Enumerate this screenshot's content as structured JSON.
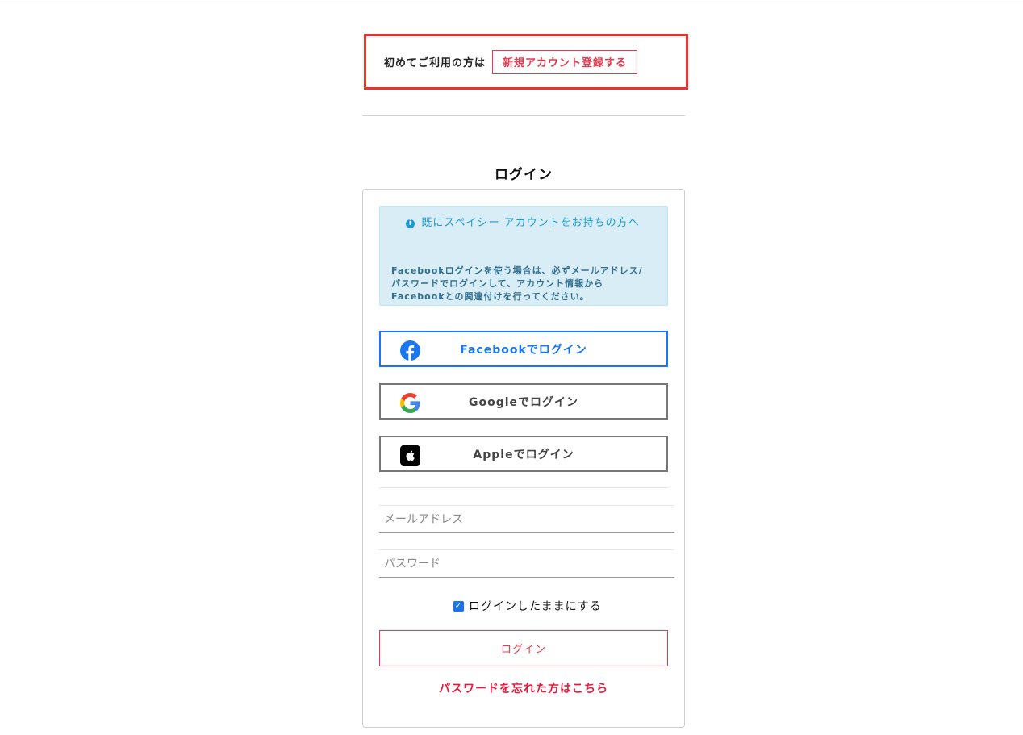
{
  "signup": {
    "lead_text": "初めてご利用の方は",
    "button_label": "新規アカウント登録する"
  },
  "login": {
    "title": "ログイン",
    "info": {
      "heading": "既にスペイシー アカウントをお持ちの方へ",
      "body": "Facebookログインを使う場合は、必ずメールアドレス/パスワードでログインして、アカウント情報からFacebookとの関連付けを行ってください。"
    },
    "social": {
      "facebook_label": "Facebookでログイン",
      "google_label": "Googleでログイン",
      "apple_label": "Appleでログイン"
    },
    "form": {
      "email_placeholder": "メールアドレス",
      "password_placeholder": "パスワード",
      "remember_label": "ログインしたままにする",
      "remember_checked": true,
      "submit_label": "ログイン",
      "forgot_link": "パスワードを忘れた方はこちら"
    }
  },
  "colors": {
    "accent_red": "#e23b50",
    "highlight_box": "#e8342c",
    "facebook_blue": "#1877f2",
    "info_bg": "#d9edf7"
  },
  "icons": {
    "info": "info-circle-icon",
    "facebook": "facebook-logo-icon",
    "google": "google-logo-icon",
    "apple": "apple-logo-icon",
    "checkbox": "checkbox-checked-icon"
  }
}
